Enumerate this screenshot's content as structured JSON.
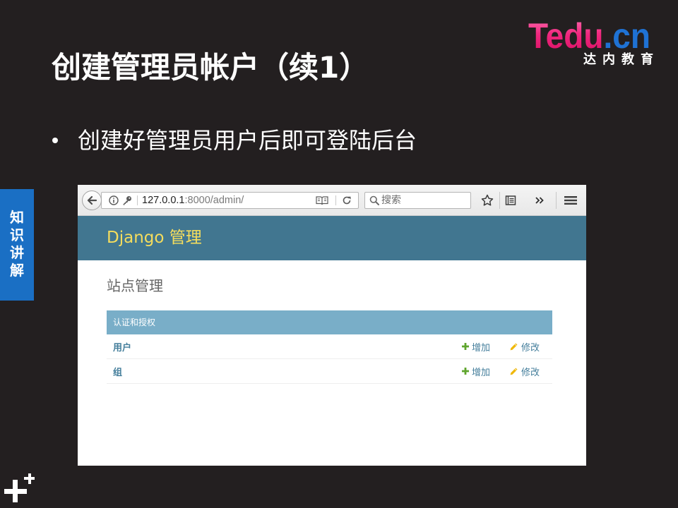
{
  "slide": {
    "title": "创建管理员帐户（续1）",
    "bullets": [
      "创建好管理员用户后即可登陆后台"
    ],
    "section_tab": "知识讲解",
    "logo": {
      "brand_main": "Tedu",
      "brand_tld": ".cn",
      "subtitle": "达内教育"
    },
    "corner_icon": "plus-logo-icon"
  },
  "browser": {
    "url": {
      "host": "127.0.0.1",
      "rest": ":8000/admin/"
    },
    "search_placeholder": "搜索",
    "icons": [
      "back-arrow-icon",
      "info-icon",
      "key-icon",
      "reader-view-icon",
      "reload-icon",
      "search-icon",
      "bookmark-star-icon",
      "library-icon",
      "overflow-chevrons-icon",
      "menu-icon"
    ]
  },
  "django": {
    "branding": "Django 管理",
    "page_title": "站点管理",
    "modules": [
      {
        "caption": "认证和授权",
        "rows": [
          {
            "name": "用户",
            "add_label": "增加",
            "change_label": "修改"
          },
          {
            "name": "组",
            "add_label": "增加",
            "change_label": "修改"
          }
        ]
      }
    ],
    "row_icons": {
      "add": "add-plus-icon",
      "change": "edit-pencil-icon"
    }
  },
  "colors": {
    "slide_background": "#231f20",
    "section_tab": "#1a6fc4",
    "logo_pink": "#f0287f",
    "logo_blue": "#1f72d4",
    "django_header": "#417690",
    "django_branding": "#f5dd5d",
    "module_caption": "#79aec8",
    "link": "#447e9b",
    "add_icon": "#5fa52d",
    "change_icon": "#efb80b"
  }
}
